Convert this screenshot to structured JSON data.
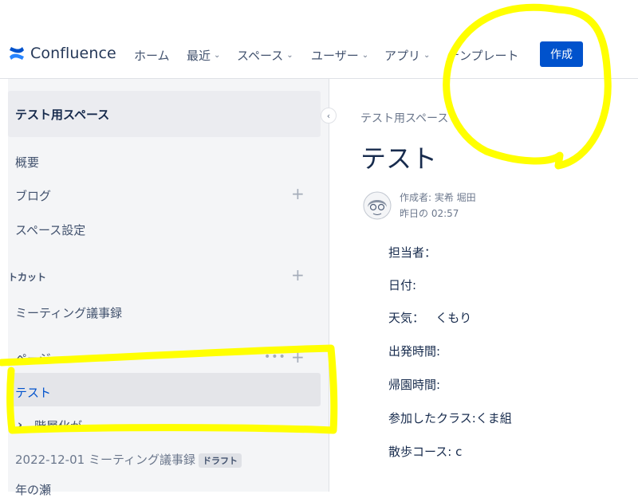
{
  "header": {
    "logo_text": "Confluence",
    "nav": [
      {
        "label": "ホーム",
        "dropdown": false
      },
      {
        "label": "最近",
        "dropdown": true
      },
      {
        "label": "スペース",
        "dropdown": true
      },
      {
        "label": "ユーザー",
        "dropdown": true
      },
      {
        "label": "アプリ",
        "dropdown": true
      },
      {
        "label": "テンプレート",
        "dropdown": false
      }
    ],
    "create_label": "作成",
    "chevron_glyph": "⌄"
  },
  "sidebar": {
    "space_name": "テスト用スペース",
    "items": {
      "overview": "概要",
      "blog": "ブログ",
      "space_settings": "スペース設定",
      "shortcuts_heading": "トカット",
      "meeting_notes": "ミーティング議事録",
      "pages_heading": "ページ",
      "test_page": "テスト",
      "tiered_page": "階層化が",
      "draft_page": "2022-12-01 ミーティング議事録",
      "draft_badge": "ドラフト",
      "last_page": "年の瀬"
    },
    "plus_glyph": "+",
    "dots_glyph": "•••",
    "collapse_glyph": "‹",
    "expand_glyph": "›"
  },
  "content": {
    "breadcrumb": "テスト用スペース",
    "title": "テスト",
    "author": "作成者: 実希 堀田",
    "date": "昨日の 02:57",
    "fields": [
      "担当者：",
      "日付:",
      "天気：   くもり",
      "出発時間:",
      "帰園時間:",
      "参加したクラス:くま組",
      "散歩コース: c"
    ]
  },
  "colors": {
    "brand": "#0052cc",
    "highlighter": "#ffff00",
    "sidebar_bg": "#f4f5f7"
  }
}
